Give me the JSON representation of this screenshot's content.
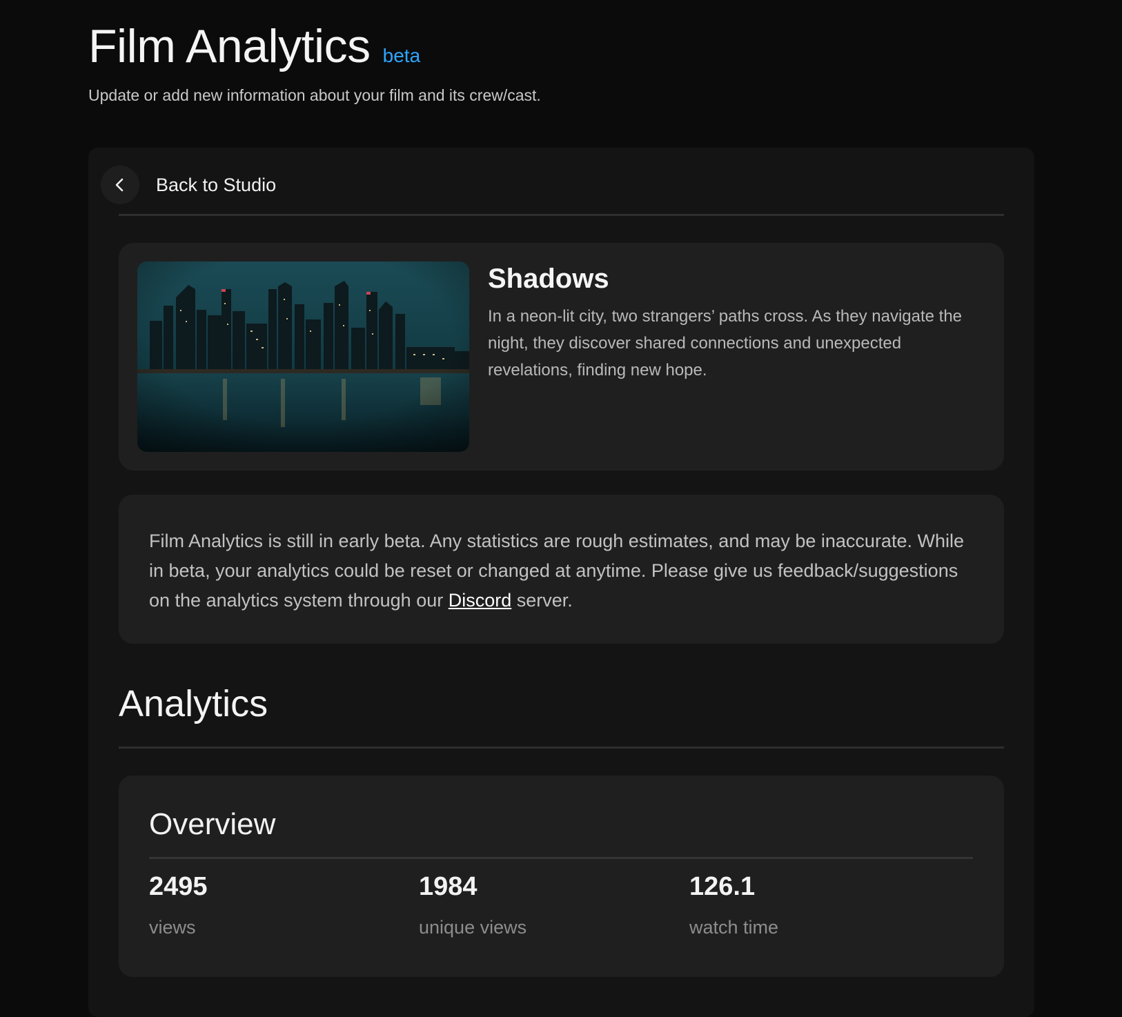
{
  "header": {
    "title": "Film Analytics",
    "badge": "beta",
    "subtitle": "Update or add new information about your film and its crew/cast."
  },
  "nav": {
    "back_label": "Back to Studio",
    "back_icon": "chevron-left-icon"
  },
  "film": {
    "title": "Shadows",
    "description": "In a neon-lit city, two strangers’ paths cross. As they navigate the night, they discover shared connections and unexpected revelations, finding new hope."
  },
  "notice": {
    "text_before": "Film Analytics is still in early beta. Any statistics are rough estimates, and may be inaccurate. While in beta, your analytics could be reset or changed at anytime. Please give us feedback/suggestions on the analytics system through our ",
    "link_label": "Discord",
    "text_after": " server."
  },
  "analytics": {
    "heading": "Analytics",
    "overview": {
      "title": "Overview",
      "stats": [
        {
          "value": "2495",
          "label": "views"
        },
        {
          "value": "1984",
          "label": "unique views"
        },
        {
          "value": "126.1",
          "label": "watch time"
        }
      ]
    }
  },
  "colors": {
    "background": "#0b0b0b",
    "panel": "#141414",
    "card": "#1f1f1f",
    "accent": "#2ea6ff"
  }
}
